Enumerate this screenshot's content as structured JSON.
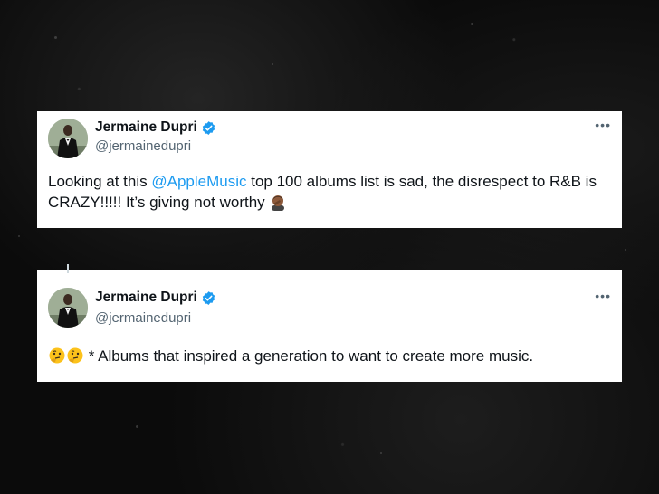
{
  "tweets": [
    {
      "display_name": "Jermaine Dupri",
      "handle": "@jermainedupri",
      "icons": {
        "avatar": "profile-photo",
        "verified": "verified-badge-icon",
        "more": "more-options-icon"
      },
      "text_before": "Looking at this ",
      "mention": "@AppleMusic",
      "text_after": " top 100 albums list is sad, the disrespect to R&B is CRAZY!!!!! It’s giving not worthy ",
      "emoji": "man-facepalming-emoji"
    },
    {
      "display_name": "Jermaine Dupri",
      "handle": "@jermainedupri",
      "icons": {
        "avatar": "profile-photo",
        "verified": "verified-badge-icon",
        "more": "more-options-icon"
      },
      "emoji": [
        "thinking-face-emoji",
        "thinking-face-emoji"
      ],
      "text": " * Albums that inspired a generation to want to create more music."
    }
  ],
  "colors": {
    "verified_blue": "#1d9bf0",
    "mention_blue": "#1d9bf0",
    "text": "#0f1419",
    "secondary_text": "#536471",
    "background": "#0b0b0b"
  }
}
